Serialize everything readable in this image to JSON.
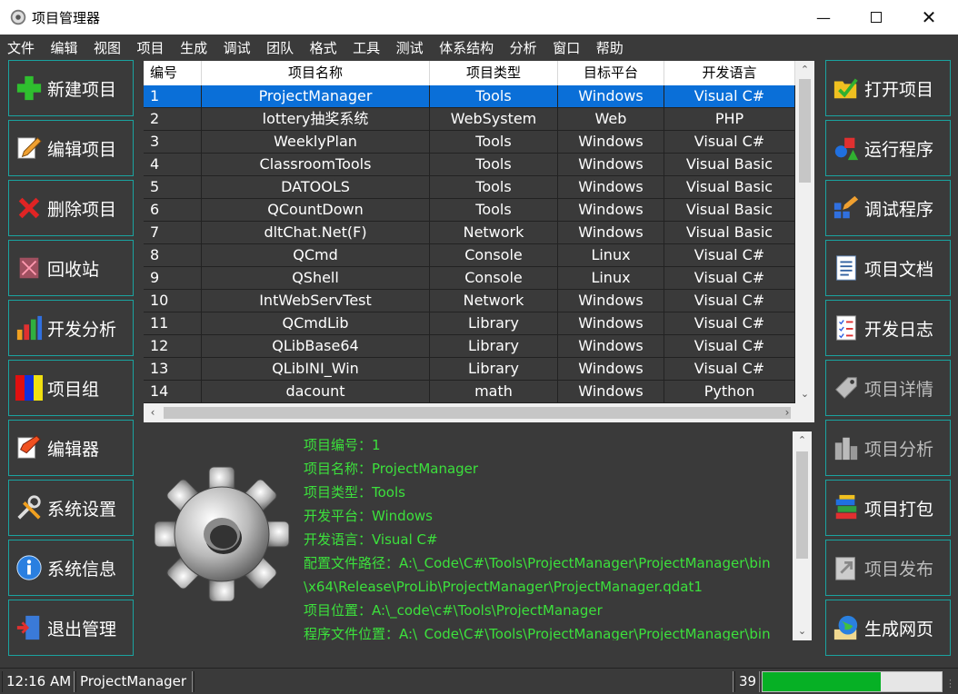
{
  "window": {
    "title": "项目管理器"
  },
  "menu": [
    "文件",
    "编辑",
    "视图",
    "项目",
    "生成",
    "调试",
    "团队",
    "格式",
    "工具",
    "测试",
    "体系结构",
    "分析",
    "窗口",
    "帮助"
  ],
  "left_buttons": [
    {
      "label": "新建项目",
      "icon": "plus-icon"
    },
    {
      "label": "编辑项目",
      "icon": "pencil-icon"
    },
    {
      "label": "删除项目",
      "icon": "delete-x-icon"
    },
    {
      "label": "回收站",
      "icon": "recycle-bin-icon"
    },
    {
      "label": "开发分析",
      "icon": "bar-chart-icon"
    },
    {
      "label": "项目组",
      "icon": "color-blocks-icon"
    },
    {
      "label": "编辑器",
      "icon": "edit-page-icon"
    },
    {
      "label": "系统设置",
      "icon": "tools-icon"
    },
    {
      "label": "系统信息",
      "icon": "info-icon"
    },
    {
      "label": "退出管理",
      "icon": "exit-door-icon"
    }
  ],
  "right_buttons": [
    {
      "label": "打开项目",
      "icon": "open-folder-icon",
      "enabled": true
    },
    {
      "label": "运行程序",
      "icon": "run-shapes-icon",
      "enabled": true
    },
    {
      "label": "调试程序",
      "icon": "debug-pencil-icon",
      "enabled": true
    },
    {
      "label": "项目文档",
      "icon": "document-icon",
      "enabled": true
    },
    {
      "label": "开发日志",
      "icon": "log-checklist-icon",
      "enabled": true
    },
    {
      "label": "项目详情",
      "icon": "tag-icon",
      "enabled": false
    },
    {
      "label": "项目分析",
      "icon": "analysis-cylinders-icon",
      "enabled": false
    },
    {
      "label": "项目打包",
      "icon": "package-books-icon",
      "enabled": true
    },
    {
      "label": "项目发布",
      "icon": "publish-icon",
      "enabled": false
    },
    {
      "label": "生成网页",
      "icon": "globe-icon",
      "enabled": true
    }
  ],
  "table": {
    "columns": [
      "编号",
      "项目名称",
      "项目类型",
      "目标平台",
      "开发语言"
    ],
    "rows": [
      [
        "1",
        "ProjectManager",
        "Tools",
        "Windows",
        "Visual C#"
      ],
      [
        "2",
        "lottery抽奖系统",
        "WebSystem",
        "Web",
        "PHP"
      ],
      [
        "3",
        "WeeklyPlan",
        "Tools",
        "Windows",
        "Visual C#"
      ],
      [
        "4",
        "ClassroomTools",
        "Tools",
        "Windows",
        "Visual Basic"
      ],
      [
        "5",
        "DATOOLS",
        "Tools",
        "Windows",
        "Visual Basic"
      ],
      [
        "6",
        "QCountDown",
        "Tools",
        "Windows",
        "Visual Basic"
      ],
      [
        "7",
        "dltChat.Net(F)",
        "Network",
        "Windows",
        "Visual Basic"
      ],
      [
        "8",
        "QCmd",
        "Console",
        "Linux",
        "Visual C#"
      ],
      [
        "9",
        "QShell",
        "Console",
        "Linux",
        "Visual C#"
      ],
      [
        "10",
        "IntWebServTest",
        "Network",
        "Windows",
        "Visual C#"
      ],
      [
        "11",
        "QCmdLib",
        "Library",
        "Windows",
        "Visual C#"
      ],
      [
        "12",
        "QLibBase64",
        "Library",
        "Windows",
        "Visual C#"
      ],
      [
        "13",
        "QLibINI_Win",
        "Library",
        "Windows",
        "Visual C#"
      ],
      [
        "14",
        "dacount",
        "math",
        "Windows",
        "Python"
      ]
    ],
    "selected_row": 0
  },
  "details": {
    "lines": [
      "项目编号：1",
      "项目名称：ProjectManager",
      "项目类型：Tools",
      "开发平台：Windows",
      "开发语言：Visual C#",
      "配置文件路径：A:\\_Code\\C#\\Tools\\ProjectManager\\ProjectManager\\bin",
      "\\x64\\Release\\ProLib\\ProjectManager\\ProjectManager.qdat1",
      "项目位置：A:\\_code\\c#\\Tools\\ProjectManager",
      "程序文件位置：A:\\_Code\\C#\\Tools\\ProjectManager\\ProjectManager\\bin"
    ]
  },
  "status": {
    "time": "12:16 AM",
    "project": "ProjectManager",
    "count": "39",
    "progress": 0.66
  },
  "colors": {
    "background": "#3a3a3a",
    "border_accent": "#1aa3a0",
    "selection": "#0a6fd8",
    "detail_text": "#3ce03c",
    "progress_fill": "#06b025"
  }
}
